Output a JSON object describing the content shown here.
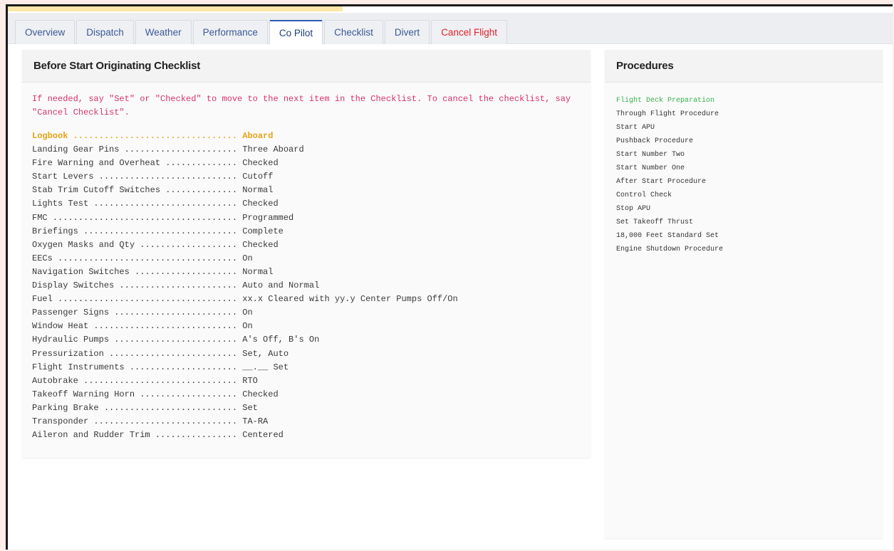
{
  "tabs": [
    {
      "label": "Overview"
    },
    {
      "label": "Dispatch"
    },
    {
      "label": "Weather"
    },
    {
      "label": "Performance"
    },
    {
      "label": "Co Pilot"
    },
    {
      "label": "Checklist"
    },
    {
      "label": "Divert"
    },
    {
      "label": "Cancel Flight"
    }
  ],
  "colors": {
    "active_tab_accent": "#2d5db5",
    "cancel": "#e8202a",
    "current_item": "#e8a317",
    "instruction": "#d6336c",
    "active_procedure": "#36b24a"
  },
  "checklist": {
    "title": "Before Start Originating Checklist",
    "instructions": "If needed, say \"Set\" or \"Checked\" to move to the next item in the Checklist. To cancel the checklist, say \"Cancel Checklist\".",
    "items": [
      "Logbook ................................ Aboard",
      "Landing Gear Pins ...................... Three Aboard",
      "Fire Warning and Overheat .............. Checked",
      "Start Levers ........................... Cutoff",
      "Stab Trim Cutoff Switches .............. Normal",
      "Lights Test ............................ Checked",
      "FMC .................................... Programmed",
      "Briefings .............................. Complete",
      "Oxygen Masks and Qty ................... Checked",
      "EECs ................................... On",
      "Navigation Switches .................... Normal",
      "Display Switches ....................... Auto and Normal",
      "Fuel ................................... xx.x Cleared with yy.y Center Pumps Off/On",
      "Passenger Signs ........................ On",
      "Window Heat ............................ On",
      "Hydraulic Pumps ........................ A's Off, B's On",
      "Pressurization ......................... Set, Auto",
      "Flight Instruments ..................... __.__ Set",
      "Autobrake .............................. RTO",
      "Takeoff Warning Horn ................... Checked",
      "Parking Brake .......................... Set",
      "Transponder ............................ TA-RA",
      "Aileron and Rudder Trim ................ Centered"
    ]
  },
  "procedures": {
    "title": "Procedures",
    "items": [
      "Flight Deck Preparation",
      "Through Flight Procedure",
      "Start APU",
      "Pushback Procedure",
      "Start Number Two",
      "Start Number One",
      "After Start Procedure",
      "Control Check",
      "Stop APU",
      "Set Takeoff Thrust",
      "18,000 Feet Standard Set",
      "Engine Shutdown Procedure"
    ]
  }
}
